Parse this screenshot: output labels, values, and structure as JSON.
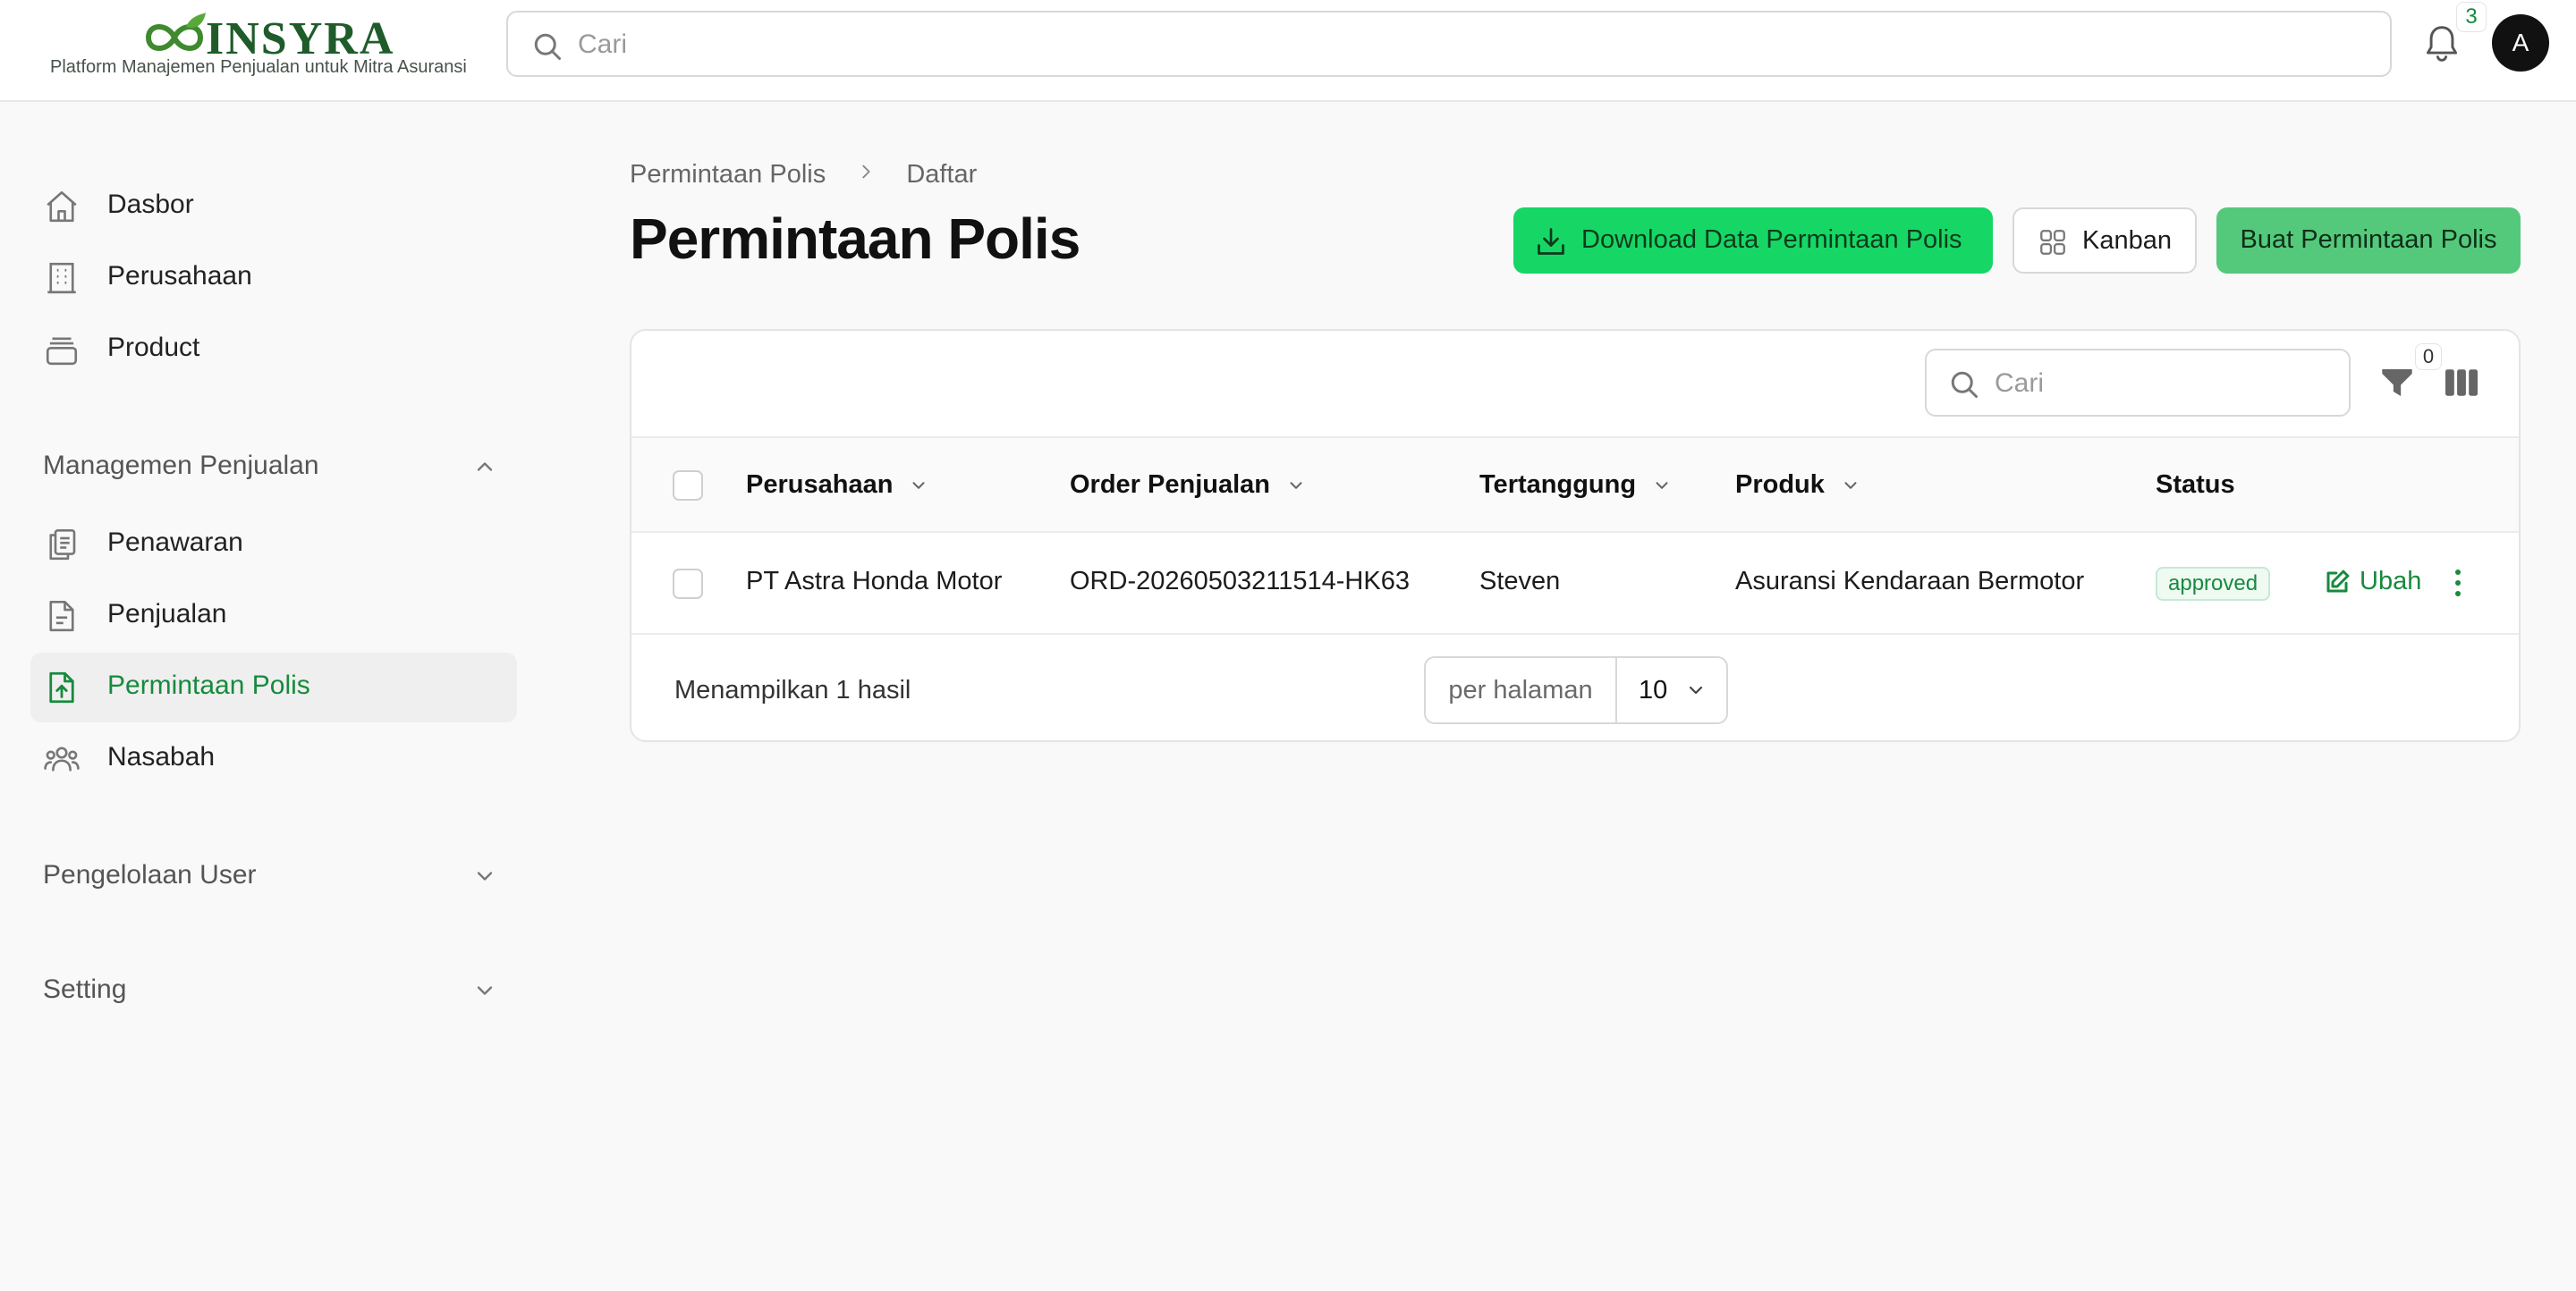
{
  "app": {
    "brand": "INSYRA",
    "tagline": "Platform Manajemen Penjualan untuk Mitra Asuransi",
    "brand_color": "#1f5c2a",
    "accent_color": "#178a3d"
  },
  "topbar": {
    "search_placeholder": "Cari",
    "notification_count": "3",
    "avatar_initial": "A"
  },
  "sidebar": {
    "items": [
      {
        "label": "Dasbor",
        "icon": "home-icon"
      },
      {
        "label": "Perusahaan",
        "icon": "building-icon"
      },
      {
        "label": "Product",
        "icon": "archive-box-icon"
      }
    ],
    "groups": [
      {
        "label": "Managemen Penjualan",
        "expanded": true,
        "items": [
          {
            "label": "Penawaran",
            "icon": "clipboard-icon"
          },
          {
            "label": "Penjualan",
            "icon": "document-icon"
          },
          {
            "label": "Permintaan Polis",
            "icon": "document-upload-icon",
            "active": true
          },
          {
            "label": "Nasabah",
            "icon": "users-icon"
          }
        ]
      },
      {
        "label": "Pengelolaan User",
        "expanded": false
      },
      {
        "label": "Setting",
        "expanded": false
      }
    ]
  },
  "breadcrumb": [
    "Permintaan Polis",
    "Daftar"
  ],
  "page": {
    "title": "Permintaan Polis",
    "actions": {
      "download": "Download Data Permintaan Polis",
      "kanban": "Kanban",
      "create": "Buat Permintaan Polis"
    }
  },
  "table": {
    "search_placeholder": "Cari",
    "filter_count": "0",
    "columns": [
      "Perusahaan",
      "Order Penjualan",
      "Tertanggung",
      "Produk",
      "Status"
    ],
    "rows": [
      {
        "perusahaan": "PT Astra Honda Motor",
        "order": "ORD-20260503211514-HK63",
        "tertanggung": "Steven",
        "produk": "Asuransi Kendaraan Bermotor",
        "status": "approved",
        "edit_label": "Ubah"
      }
    ],
    "result_text": "Menampilkan 1 hasil",
    "per_page_label": "per halaman",
    "per_page_value": "10"
  }
}
